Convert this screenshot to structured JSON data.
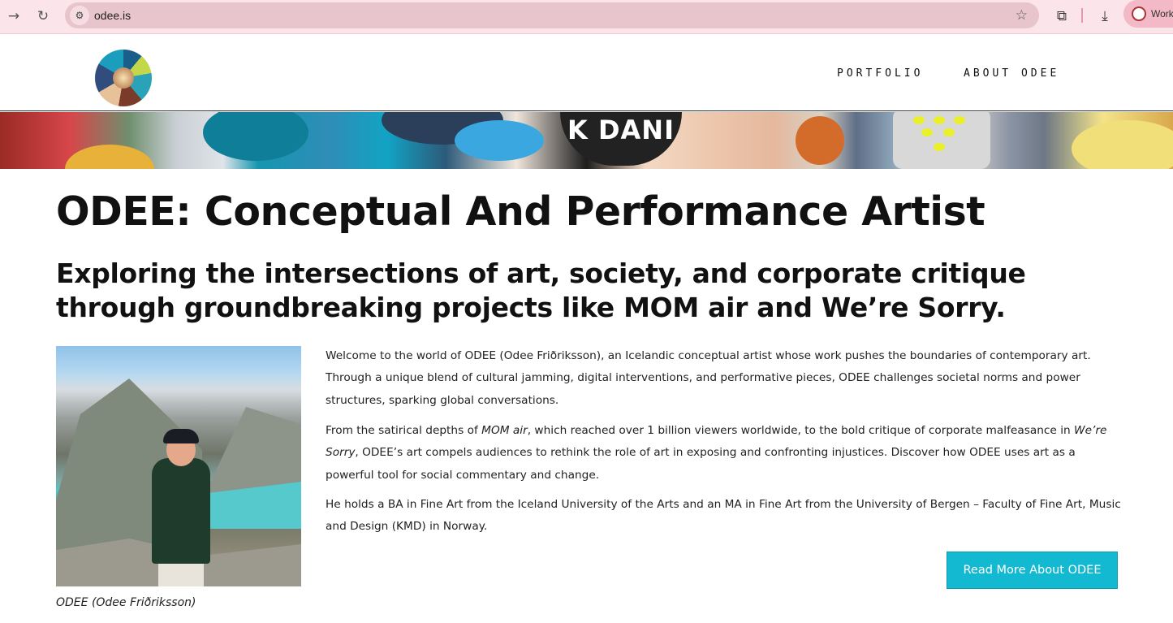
{
  "browser": {
    "url": "odee.is",
    "profile_label": "Work",
    "icons": [
      "forward-icon",
      "reload-icon",
      "site-info-icon",
      "bookmark-star-icon",
      "extensions-icon",
      "download-icon"
    ]
  },
  "site": {
    "nav": [
      {
        "label": "PORTFOLIO"
      },
      {
        "label": "ABOUT ODEE"
      }
    ],
    "banner_text": "K DANI"
  },
  "main": {
    "title": "ODEE: Conceptual And Performance Artist",
    "subtitle": "Exploring the intersections of art, society, and corporate critique through groundbreaking projects like MOM air and We’re Sorry.",
    "photo_caption": "ODEE (Odee Friðriksson)",
    "paragraphs": {
      "p1": "Welcome to the world of ODEE (Odee Friðriksson), an Icelandic conceptual artist whose work pushes the boundaries of contemporary art. Through a unique blend of cultural jamming, digital interventions, and performative pieces, ODEE challenges societal norms and power structures, sparking global conversations.",
      "p2_a": "From the satirical depths of ",
      "p2_em1": "MOM air",
      "p2_b": ", which reached over 1 billion viewers worldwide, to the bold critique of corporate malfeasance in ",
      "p2_em2": "We’re Sorry",
      "p2_c": ", ODEE’s art compels audiences to rethink the role of art in exposing and confronting injustices. Discover how ODEE uses art as a powerful tool for social commentary and change.",
      "p3": "He holds a BA in Fine Art from the Iceland University of the Arts and an MA in Fine Art from the University of Bergen – Faculty of Fine Art, Music and Design (KMD) in Norway."
    },
    "cta_label": "Read More About ODEE"
  },
  "colors": {
    "accent": "#12b9d1",
    "chrome_bg": "#fbe4ea",
    "omnibox_bg": "#e8c4cc"
  }
}
